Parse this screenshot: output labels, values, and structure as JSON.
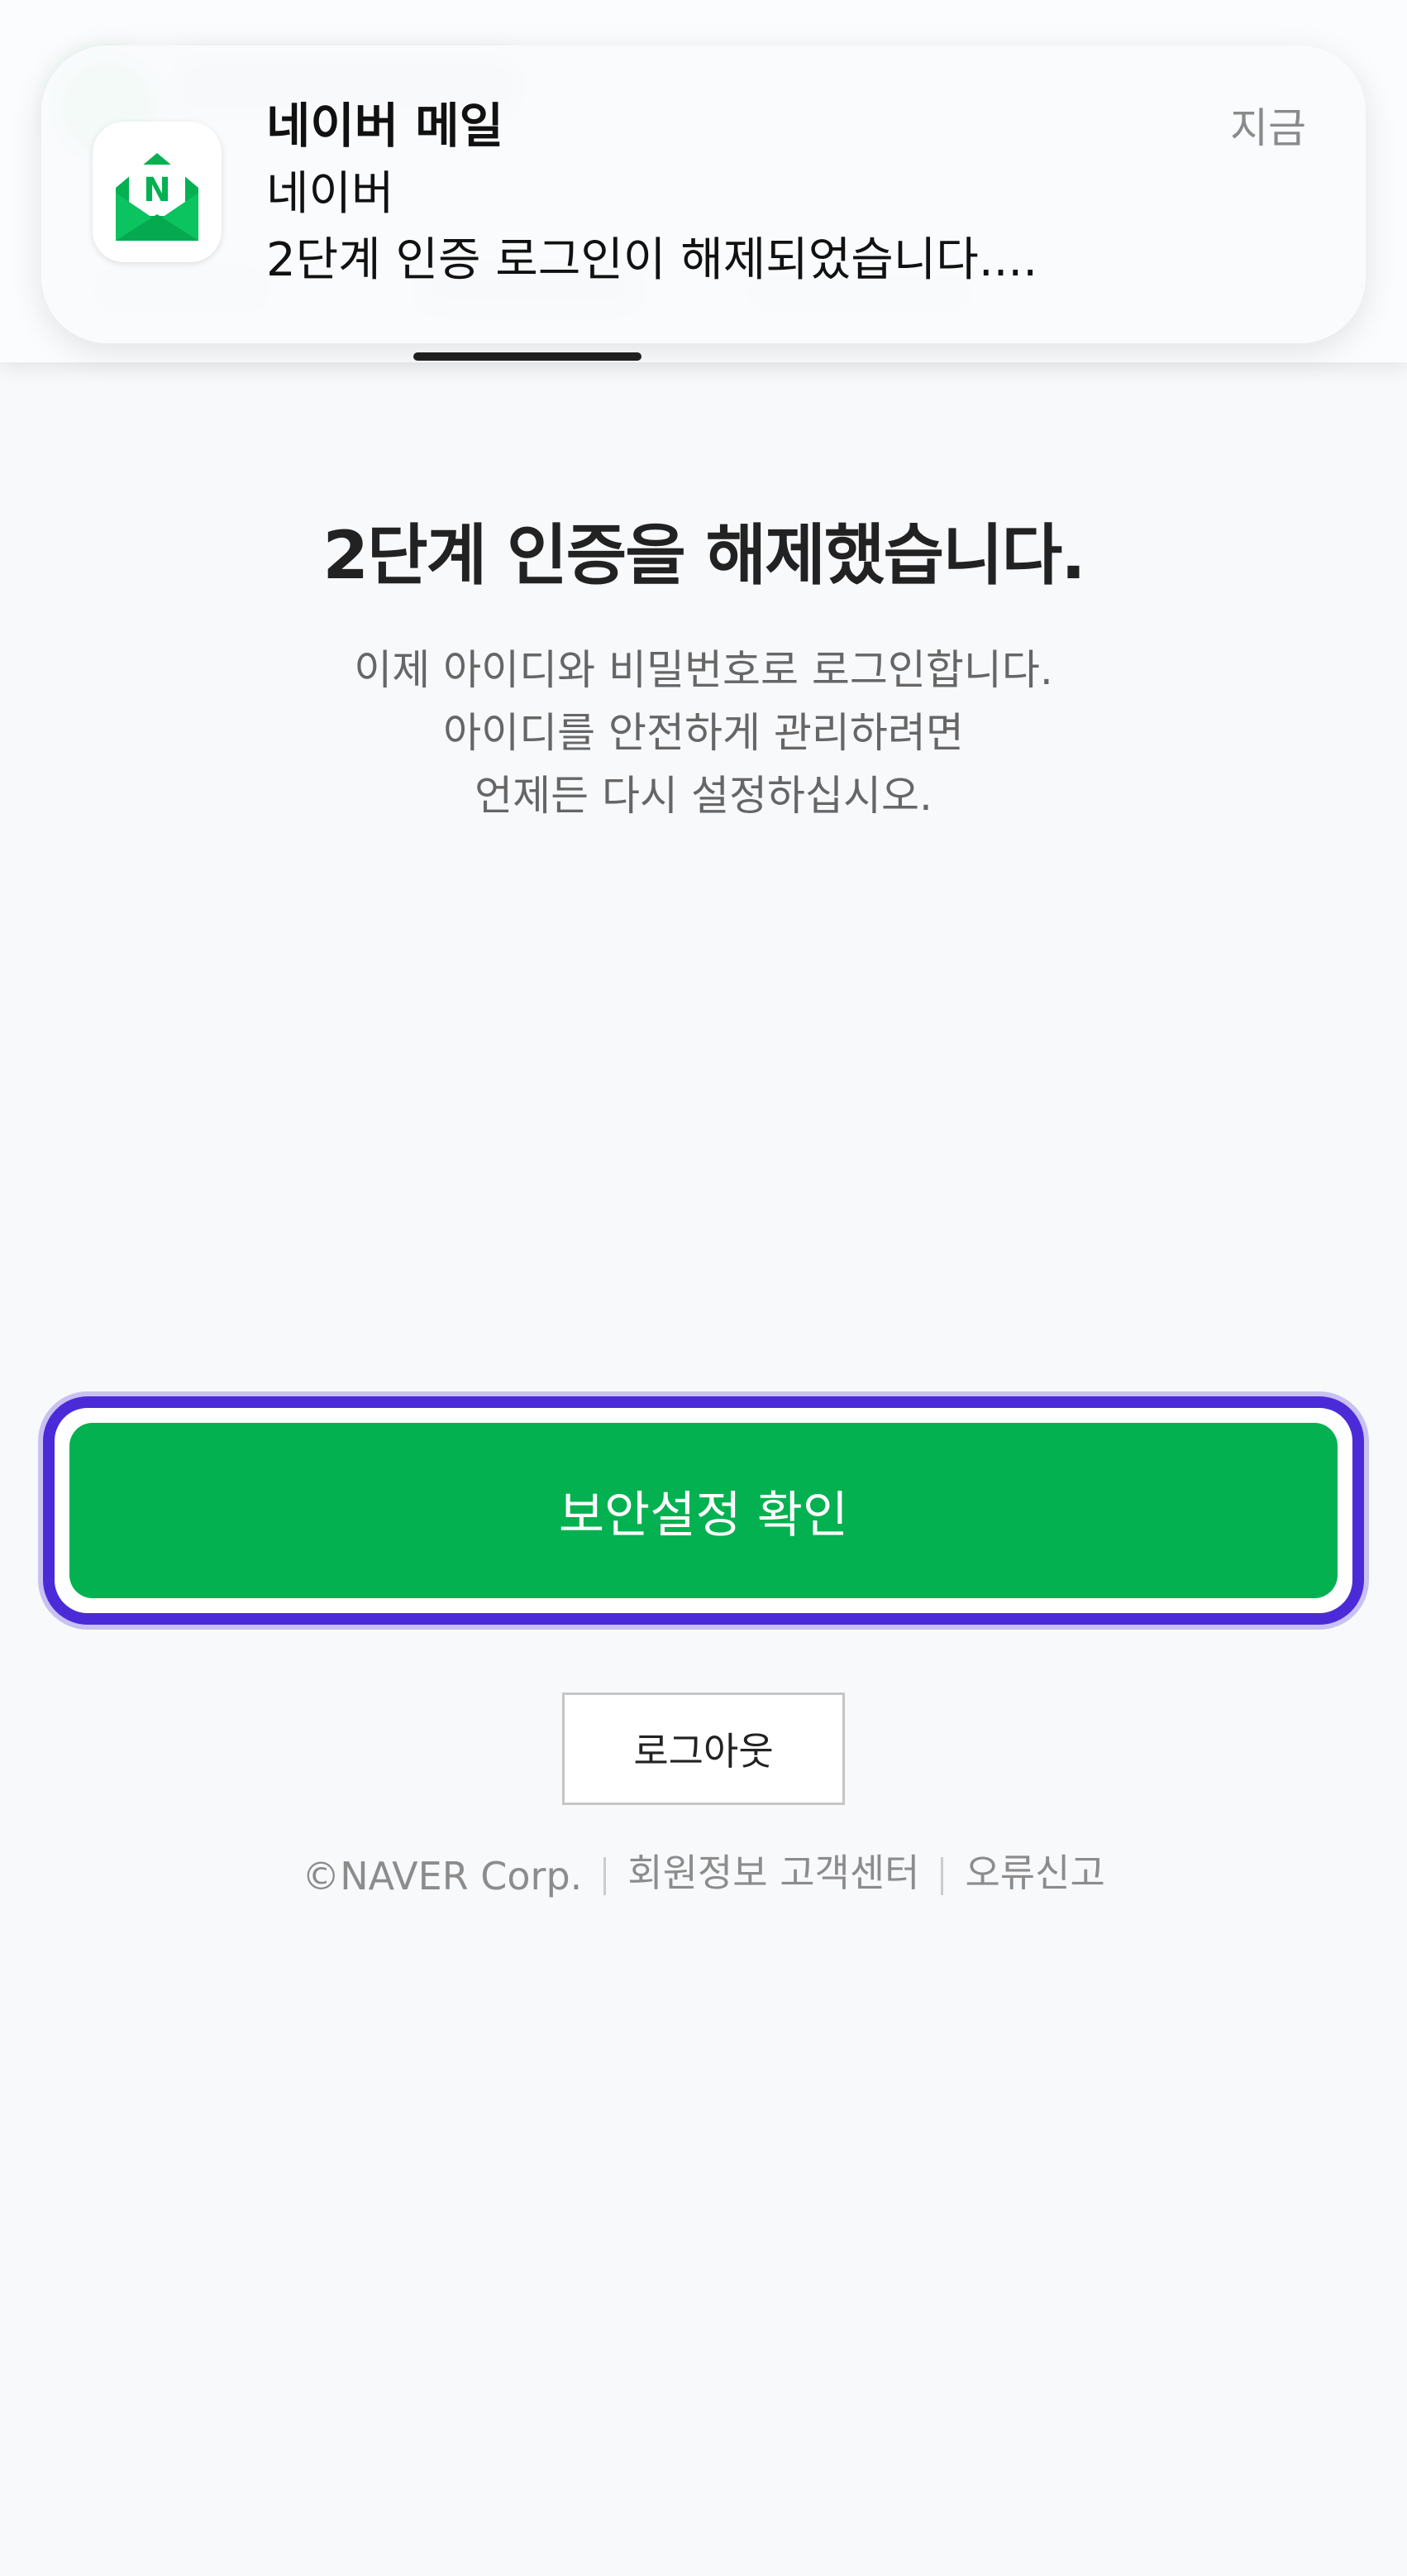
{
  "notification": {
    "app_name": "네이버 메일",
    "time": "지금",
    "sender": "네이버",
    "message": "2단계 인증 로그인이 해제되었습니다....",
    "app_icon": "naver-mail-envelope-icon"
  },
  "main": {
    "title": "2단계 인증을 해제했습니다.",
    "description_lines": [
      "이제 아이디와 비밀번호로 로그인합니다.",
      "아이디를 안전하게 관리하려면",
      "언제든 다시 설정하십시오."
    ],
    "primary_button_label": "보안설정 확인",
    "logout_button_label": "로그아웃"
  },
  "footer": {
    "copyright": "©NAVER Corp.",
    "links": [
      "회원정보 고객센터",
      "오류신고"
    ]
  },
  "colors": {
    "primary_green": "#03b150",
    "focus_ring": "#4b2bd8",
    "background": "#f8f9fb"
  }
}
